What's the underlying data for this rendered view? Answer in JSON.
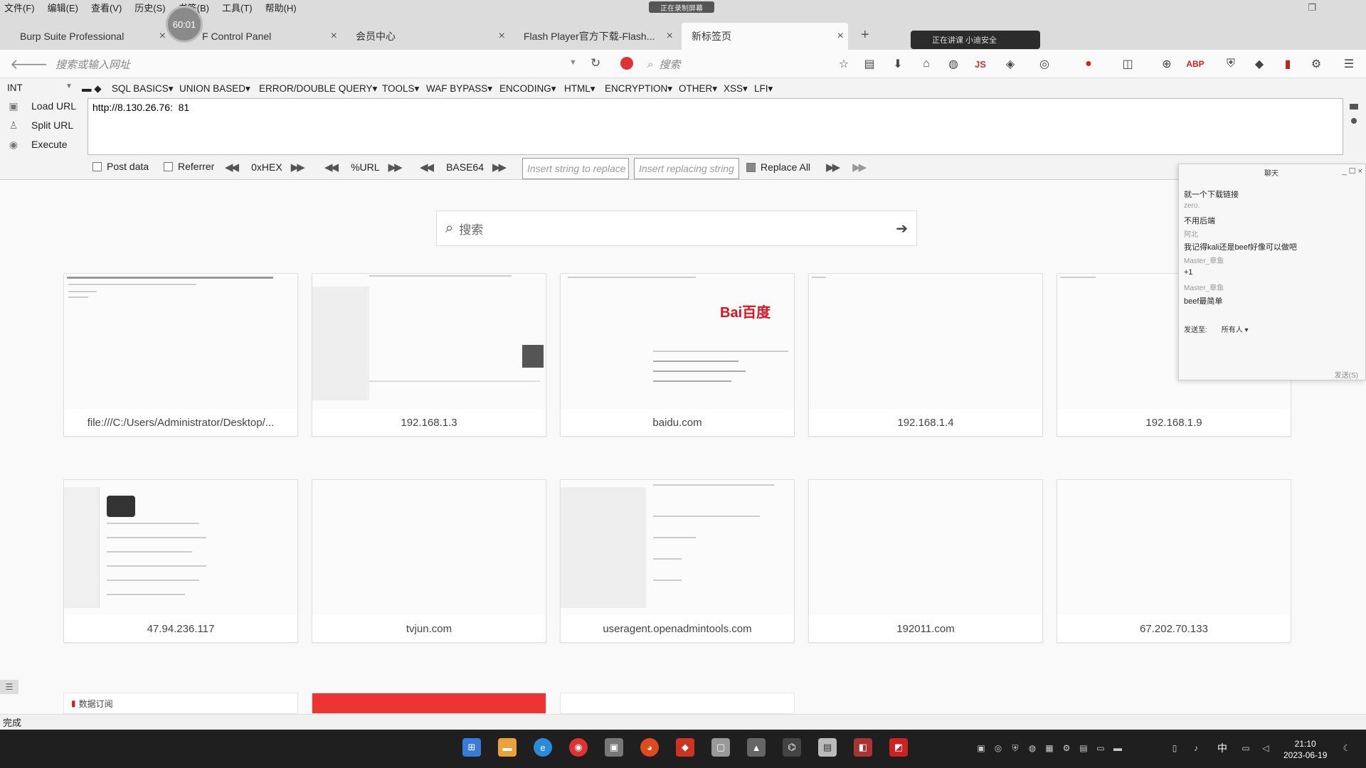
{
  "menubar": {
    "items": [
      "文件(F)",
      "编辑(E)",
      "查看(V)",
      "历史(S)",
      "书签(B)",
      "工具(T)",
      "帮助(H)"
    ],
    "recording": "正在录制屏幕"
  },
  "timer": "60:01",
  "tabs": [
    {
      "title": "Burp Suite Professional"
    },
    {
      "title": "F Control Panel"
    },
    {
      "title": "会员中心"
    },
    {
      "title": "Flash Player官方下载-Flash..."
    },
    {
      "title": "新标签页"
    }
  ],
  "live_pill": "正在讲课  小迪安全",
  "navbar": {
    "address_placeholder": "搜索或输入网址",
    "search_placeholder": "搜索"
  },
  "hackbar": {
    "select_value": "INT",
    "menu": [
      "SQL BASICS▾",
      "UNION BASED▾",
      "ERROR/DOUBLE QUERY▾",
      "TOOLS▾",
      "WAF BYPASS▾",
      "ENCODING▾",
      "HTML▾",
      "ENCRYPTION▾",
      "OTHER▾",
      "XSS▾",
      "LFI▾"
    ],
    "load_url": "Load URL",
    "split_url": "Split URL",
    "execute": "Execute",
    "url_value": "http://8.130.26.76:  81",
    "post_data": "Post data",
    "referrer": "Referrer",
    "hex": "0xHEX",
    "url_enc": "%URL",
    "base64": "BASE64",
    "replace_placeholder": "Insert string to replace",
    "replacing_placeholder": "Insert replacing string",
    "replace_all": "Replace All"
  },
  "ntp": {
    "search_placeholder": "搜索",
    "tiles": [
      {
        "label": "file:///C:/Users/Administrator/Desktop/..."
      },
      {
        "label": "192.168.1.3"
      },
      {
        "label": "baidu.com"
      },
      {
        "label": "192.168.1.4"
      },
      {
        "label": "192.168.1.9"
      },
      {
        "label": "47.94.236.117"
      },
      {
        "label": "tvjun.com"
      },
      {
        "label": "useragent.openadmintools.com"
      },
      {
        "label": "192011.com"
      },
      {
        "label": "67.202.70.133"
      }
    ],
    "partial_tiles": [
      "数据订阅",
      "",
      ""
    ],
    "baidu_logo": "Bai百度"
  },
  "chat": {
    "title": "聊天",
    "lines": [
      {
        "name": "zero",
        "text": "就一个下载链接"
      },
      {
        "name": "zero.",
        "text": "不用后端"
      },
      {
        "name": "阿北",
        "text": "我记得kali还是beef好像可以做吧"
      },
      {
        "name": "Master_章鱼",
        "text": "+1"
      },
      {
        "name": "Master_章鱼",
        "text": "beef最简单"
      }
    ],
    "send_to_label": "发送至:",
    "send_to_value": "所有人 ▾",
    "send_button": "发送(S)"
  },
  "status": "完成",
  "clock": {
    "time": "21:10",
    "date": "2023-06-19"
  },
  "ime": "中"
}
